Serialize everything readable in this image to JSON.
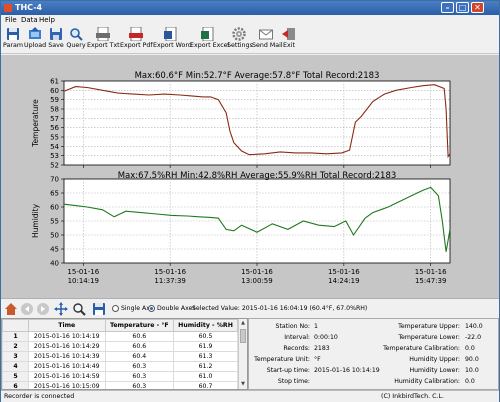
{
  "window": {
    "title": "THC-4",
    "minimize": "–",
    "maximize": "□",
    "close": "✕"
  },
  "menu": [
    "File",
    "Data",
    "Help"
  ],
  "toolbar": [
    {
      "label": "Param",
      "icon": "save-disk-icon"
    },
    {
      "label": "Upload",
      "icon": "upload-icon"
    },
    {
      "label": "Save",
      "icon": "save-icon"
    },
    {
      "label": "Query",
      "icon": "search-icon"
    },
    {
      "label": "Export Txt",
      "icon": "txt-file-icon"
    },
    {
      "label": "Export Pdf",
      "icon": "pdf-file-icon"
    },
    {
      "label": "Export Word",
      "icon": "word-file-icon"
    },
    {
      "label": "Export Excel",
      "icon": "excel-file-icon"
    },
    {
      "label": "Settings",
      "icon": "gear-icon"
    },
    {
      "label": "Send Mail",
      "icon": "mail-icon"
    },
    {
      "label": "Exit",
      "icon": "exit-icon"
    }
  ],
  "chart_data": [
    {
      "type": "line",
      "title": "Max:60.6°F  Min:52.7°F  Average:57.8°F  Total Record:2183",
      "ylabel": "Temperature",
      "ylim": [
        52,
        61
      ],
      "yticks": [
        "52",
        "53",
        "54",
        "55",
        "56",
        "57",
        "58",
        "59",
        "60",
        "61"
      ],
      "xlabels": [
        [
          "15-01-16",
          "10:14:19"
        ],
        [
          "15-01-16",
          "11:37:39"
        ],
        [
          "15-01-16",
          "13:00:59"
        ],
        [
          "15-01-16",
          "14:24:19"
        ],
        [
          "15-01-16",
          "15:47:39"
        ]
      ],
      "color": "#8b2a14",
      "series": [
        {
          "x": [
            0,
            0.03,
            0.06,
            0.1,
            0.14,
            0.18,
            0.22,
            0.26,
            0.3,
            0.33,
            0.36,
            0.38,
            0.4,
            0.42,
            0.43,
            0.44,
            0.46,
            0.48,
            0.52,
            0.56,
            0.6,
            0.64,
            0.68,
            0.72,
            0.74,
            0.755,
            0.77,
            0.8,
            0.83,
            0.86,
            0.9,
            0.93,
            0.96,
            0.985,
            0.99,
            0.995,
            1.0
          ],
          "y": [
            59.9,
            60.4,
            60.3,
            60.0,
            59.7,
            59.6,
            59.5,
            59.6,
            59.5,
            59.4,
            59.3,
            59.3,
            59.0,
            57.6,
            55.6,
            54.4,
            53.5,
            53.1,
            53.2,
            53.4,
            53.3,
            53.3,
            53.2,
            53.3,
            53.6,
            56.6,
            57.2,
            58.8,
            59.6,
            60.0,
            60.3,
            60.5,
            60.6,
            60.2,
            58.0,
            52.9,
            53.2
          ]
        }
      ]
    },
    {
      "type": "line",
      "title": "Max:67.5%RH  Min:42.8%RH  Average:55.9%RH  Total Record:2183",
      "ylabel": "Humidity",
      "ylim": [
        40,
        70
      ],
      "yticks": [
        "40",
        "45",
        "50",
        "55",
        "60",
        "65",
        "70"
      ],
      "xlabels": [
        [
          "15-01-16",
          "10:14:19"
        ],
        [
          "15-01-16",
          "11:37:39"
        ],
        [
          "15-01-16",
          "13:00:59"
        ],
        [
          "15-01-16",
          "14:24:19"
        ],
        [
          "15-01-16",
          "15:47:39"
        ]
      ],
      "color": "#1f7a1f",
      "series": [
        {
          "x": [
            0,
            0.03,
            0.06,
            0.1,
            0.13,
            0.16,
            0.2,
            0.24,
            0.28,
            0.32,
            0.35,
            0.38,
            0.4,
            0.42,
            0.44,
            0.46,
            0.5,
            0.54,
            0.58,
            0.62,
            0.66,
            0.7,
            0.73,
            0.75,
            0.78,
            0.8,
            0.84,
            0.87,
            0.9,
            0.93,
            0.95,
            0.97,
            0.98,
            0.99,
            1.0
          ],
          "y": [
            61.0,
            60.5,
            60.0,
            59.0,
            56.5,
            58.5,
            58.0,
            57.5,
            57.0,
            56.8,
            56.5,
            56.3,
            56.0,
            52.0,
            51.5,
            53.5,
            51.0,
            54.0,
            52.0,
            55.0,
            53.5,
            53.0,
            55.0,
            50.0,
            56.0,
            58.0,
            60.0,
            62.0,
            64.0,
            66.0,
            67.0,
            64.0,
            55.0,
            44.0,
            52.0
          ]
        }
      ]
    }
  ],
  "controls": {
    "single_axis": "Single Axis",
    "double_axes": "Double Axes",
    "selected_value": "Selected Value: 2015-01-16 16:04:19 (60.4°F, 67.0%RH)"
  },
  "table": {
    "headers": [
      "",
      "Time",
      "Temperature - °F",
      "Humidity - %RH"
    ],
    "rows": [
      [
        "1",
        "2015-01-16 10:14:19",
        "60.6",
        "60.5"
      ],
      [
        "2",
        "2015-01-16 10:14:29",
        "60.6",
        "61.9"
      ],
      [
        "3",
        "2015-01-16 10:14:39",
        "60.4",
        "61.3"
      ],
      [
        "4",
        "2015-01-16 10:14:49",
        "60.3",
        "61.2"
      ],
      [
        "5",
        "2015-01-16 10:14:59",
        "60.3",
        "61.0"
      ],
      [
        "6",
        "2015-01-16 10:15:09",
        "60.3",
        "60.7"
      ]
    ]
  },
  "info": {
    "station_no_label": "Station No:",
    "station_no": "1",
    "interval_label": "Interval:",
    "interval": "0:00:10",
    "records_label": "Records:",
    "records": "2183",
    "temp_unit_label": "Temperature Unit:",
    "temp_unit": "°F",
    "startup_label": "Start-up time:",
    "startup": "2015-01-16 10:14:19",
    "stop_label": "Stop time:",
    "stop": "",
    "temp_upper_label": "Temperature Upper:",
    "temp_upper": "140.0",
    "temp_lower_label": "Temperature Lower:",
    "temp_lower": "-22.0",
    "temp_cal_label": "Temperature Calibration:",
    "temp_cal": "0.0",
    "hum_upper_label": "Humidity Upper:",
    "hum_upper": "90.0",
    "hum_lower_label": "Humidity Lower:",
    "hum_lower": "10.0",
    "hum_cal_label": "Humidity Calibration:",
    "hum_cal": "0.0"
  },
  "status": {
    "left": "Recorder is connected",
    "right": "(C) InkbirdTech. C.L."
  }
}
